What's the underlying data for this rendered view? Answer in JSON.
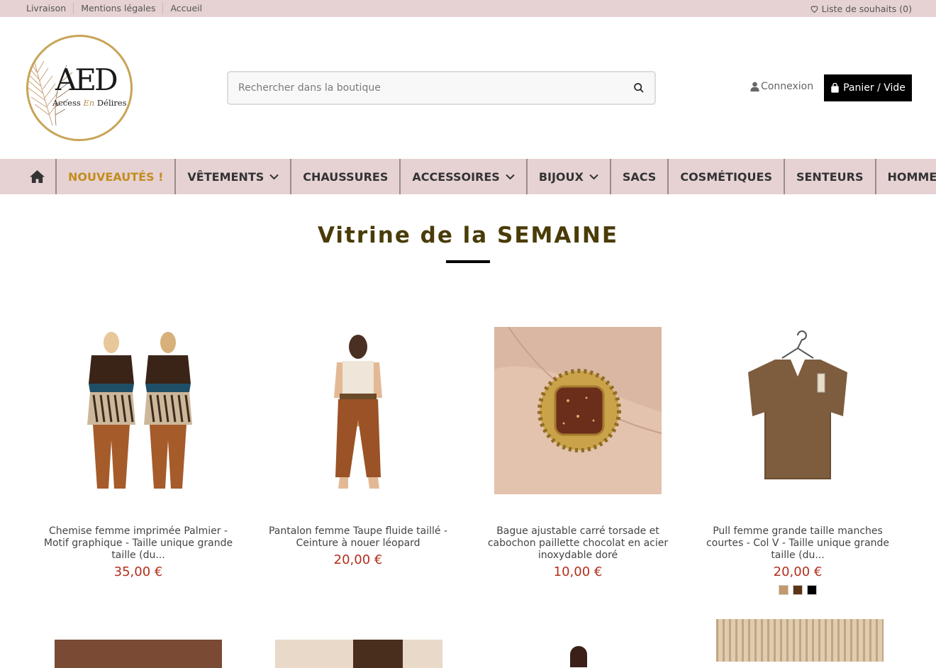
{
  "topbar": {
    "links": [
      "Livraison",
      "Mentions légales",
      "Accueil"
    ],
    "wishlist": "Liste de souhaits (0)"
  },
  "header": {
    "logo": {
      "letters": "AED",
      "tagline_prefix": "Access ",
      "tagline_mid": "En",
      "tagline_suffix": " Délires"
    },
    "search_placeholder": "Rechercher dans la boutique",
    "login": "Connexion",
    "cart": "Panier / Vide"
  },
  "nav": [
    {
      "label": "NOUVEAUTÉS !",
      "dropdown": false
    },
    {
      "label": "VÊTEMENTS",
      "dropdown": true
    },
    {
      "label": "CHAUSSURES",
      "dropdown": false
    },
    {
      "label": "ACCESSOIRES",
      "dropdown": true
    },
    {
      "label": "BIJOUX",
      "dropdown": true
    },
    {
      "label": "SACS",
      "dropdown": false
    },
    {
      "label": "COSMÉTIQUES",
      "dropdown": false
    },
    {
      "label": "SENTEURS",
      "dropdown": false
    },
    {
      "label": "HOMMES",
      "dropdown": false
    }
  ],
  "section": {
    "title": "Vitrine de la SEMAINE"
  },
  "products": [
    {
      "name": "Chemise femme imprimée Palmier - Motif graphique - Taille unique grande taille (du...",
      "price": "35,00 €"
    },
    {
      "name": "Pantalon femme Taupe fluide taillé - Ceinture à nouer léopard",
      "price": "20,00 €"
    },
    {
      "name": "Bague ajustable carré torsade et cabochon paillette chocolat en acier inoxydable doré",
      "price": "10,00 €"
    },
    {
      "name": "Pull femme grande taille manches courtes - Col V - Taille unique grande taille (du...",
      "price": "20,00 €",
      "swatches": [
        "#c39a6b",
        "#5b3516",
        "#000000"
      ]
    }
  ],
  "colors": {
    "accent": "#c38d1f",
    "price": "#b22f1b",
    "bar": "#e6d2d3",
    "title": "#4a3c08"
  }
}
